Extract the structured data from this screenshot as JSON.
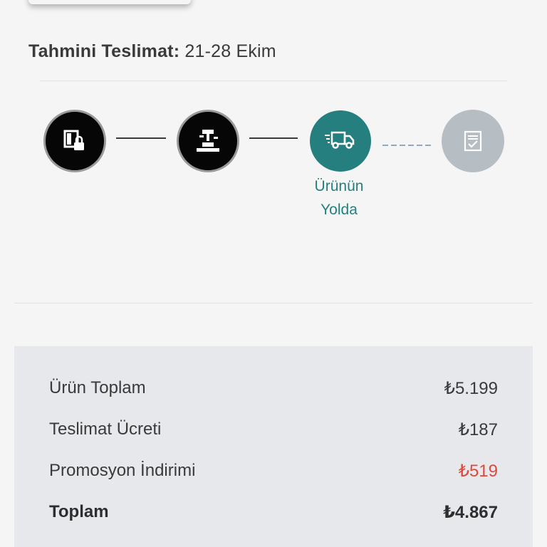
{
  "delivery": {
    "label": "Tahmini Teslimat:",
    "value": "21-28 Ekim"
  },
  "tracker": {
    "steps": [
      {
        "name": "order-placed",
        "icon": "door-lock-icon",
        "state": "done"
      },
      {
        "name": "preparing",
        "icon": "workbench-hammer-icon",
        "state": "done"
      },
      {
        "name": "in-transit",
        "icon": "delivery-truck-icon",
        "state": "active",
        "label": "Ürünün Yolda"
      },
      {
        "name": "delivered",
        "icon": "checklist-icon",
        "state": "pending"
      }
    ],
    "colors": {
      "active": "#257f7e",
      "done": "#060606",
      "pending": "#b6bdc3"
    }
  },
  "summary": {
    "rows": [
      {
        "label": "Ürün Toplam",
        "value": "₺5.199"
      },
      {
        "label": "Teslimat Ücreti",
        "value": "₺187"
      },
      {
        "label": "Promosyon İndirimi",
        "value": "₺519",
        "color": "#e0493a"
      },
      {
        "label": "Toplam",
        "value": "₺4.867"
      }
    ]
  }
}
